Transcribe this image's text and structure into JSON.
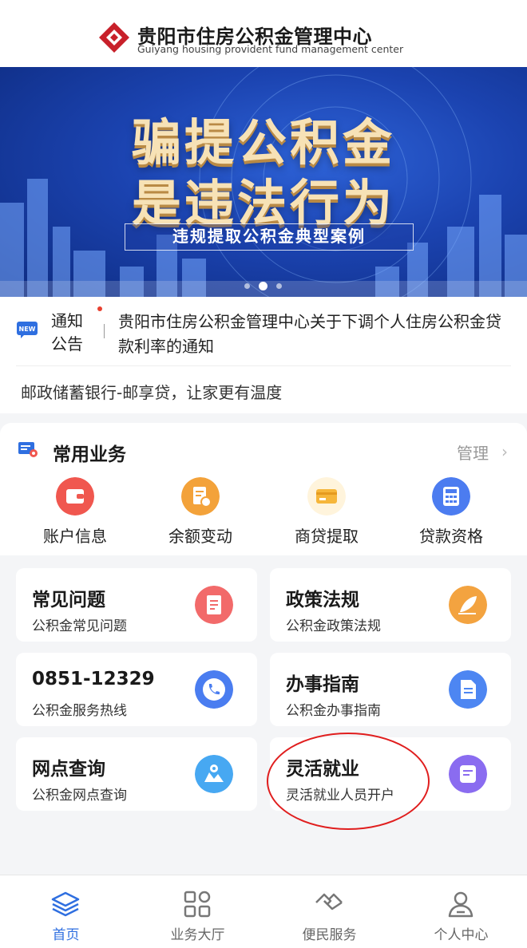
{
  "header": {
    "title": "贵阳市住房公积金管理中心",
    "subtitle": "Guiyang housing provident fund management center"
  },
  "banner": {
    "line1": "骗提公积金",
    "line2": "是违法行为",
    "tag": "违规提取公积金典型案例",
    "slide_count": 3,
    "active_slide": 2
  },
  "notice": {
    "label_line1": "通知",
    "label_line2": "公告",
    "text": "贵阳市住房公积金管理中心关于下调个人住房公积金贷款利率的通知",
    "text2": "邮政储蓄银行-邮享贷，让家更有温度",
    "badge_icon": "new-icon"
  },
  "common": {
    "title": "常用业务",
    "manage_label": "管理",
    "manage_chevron": "›",
    "items": [
      {
        "label": "账户信息",
        "icon": "wallet-icon",
        "color": "#f0574f"
      },
      {
        "label": "余额变动",
        "icon": "balance-doc-icon",
        "color": "#f3a23a"
      },
      {
        "label": "商贷提取",
        "icon": "card-icon",
        "color": "#f6b63a"
      },
      {
        "label": "贷款资格",
        "icon": "calculator-icon",
        "color": "#4c7cf0"
      }
    ]
  },
  "cards": [
    {
      "title": "常见问题",
      "sub": "公积金常见问题",
      "icon": "faq-doc-icon",
      "color": "#f26a6a"
    },
    {
      "title": "政策法规",
      "sub": "公积金政策法规",
      "icon": "quill-icon",
      "color": "#f3a340"
    },
    {
      "title": "0851-12329",
      "sub": "公积金服务热线",
      "icon": "phone-icon",
      "color": "#4a7df0"
    },
    {
      "title": "办事指南",
      "sub": "公积金办事指南",
      "icon": "guide-doc-icon",
      "color": "#4d86f2"
    },
    {
      "title": "网点查询",
      "sub": "公积金网点查询",
      "icon": "map-pin-icon",
      "color": "#47a8f2"
    },
    {
      "title": "灵活就业",
      "sub": "灵活就业人员开户",
      "icon": "form-icon",
      "color": "#8a6cf0"
    }
  ],
  "nav": [
    {
      "label": "首页",
      "icon": "layers-icon",
      "active": true
    },
    {
      "label": "业务大厅",
      "icon": "grid-icon",
      "active": false
    },
    {
      "label": "便民服务",
      "icon": "handshake-icon",
      "active": false
    },
    {
      "label": "个人中心",
      "icon": "user-icon",
      "active": false
    }
  ],
  "colors": {
    "accent": "#2f6fe0",
    "annotation_circle": "#e01e1e",
    "logo_red": "#c8202a"
  }
}
